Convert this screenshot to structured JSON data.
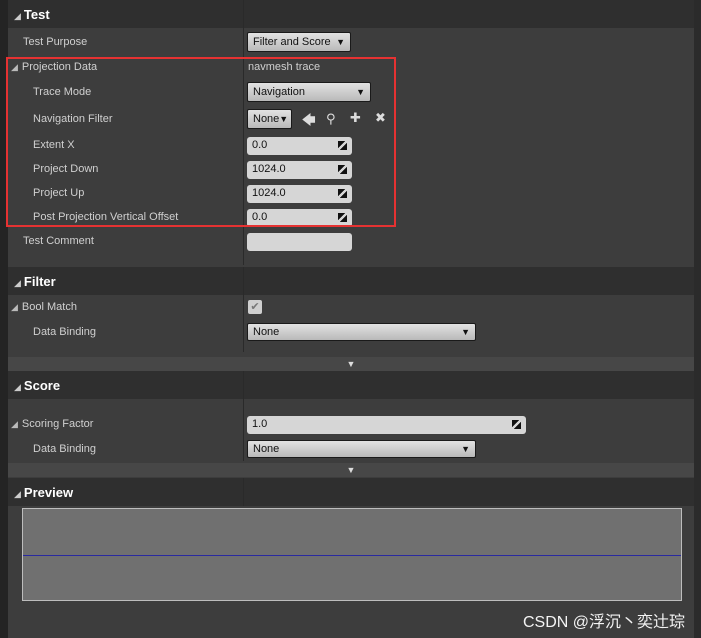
{
  "sections": {
    "test": "Test",
    "filter": "Filter",
    "score": "Score",
    "preview": "Preview"
  },
  "test": {
    "purpose_label": "Test Purpose",
    "purpose_value": "Filter and Score",
    "projection_label": "Projection Data",
    "projection_value": "navmesh trace",
    "trace_mode_label": "Trace Mode",
    "trace_mode_value": "Navigation",
    "nav_filter_label": "Navigation Filter",
    "nav_filter_value": "None",
    "extent_label": "Extent X",
    "extent_value": "0.0",
    "down_label": "Project Down",
    "down_value": "1024.0",
    "up_label": "Project Up",
    "up_value": "1024.0",
    "offset_label": "Post Projection Vertical Offset",
    "offset_value": "0.0",
    "comment_label": "Test Comment",
    "comment_value": ""
  },
  "filter": {
    "bool_label": "Bool Match",
    "bool_checked": true,
    "binding_label": "Data Binding",
    "binding_value": "None"
  },
  "score": {
    "factor_label": "Scoring Factor",
    "factor_value": "1.0",
    "binding_label": "Data Binding",
    "binding_value": "None"
  },
  "preview": {
    "line_color": "#2a2aa0",
    "line_value": 0.5
  },
  "colors": {
    "highlight": "#e63232"
  },
  "watermark": "CSDN @浮沉丶奕辻琮"
}
